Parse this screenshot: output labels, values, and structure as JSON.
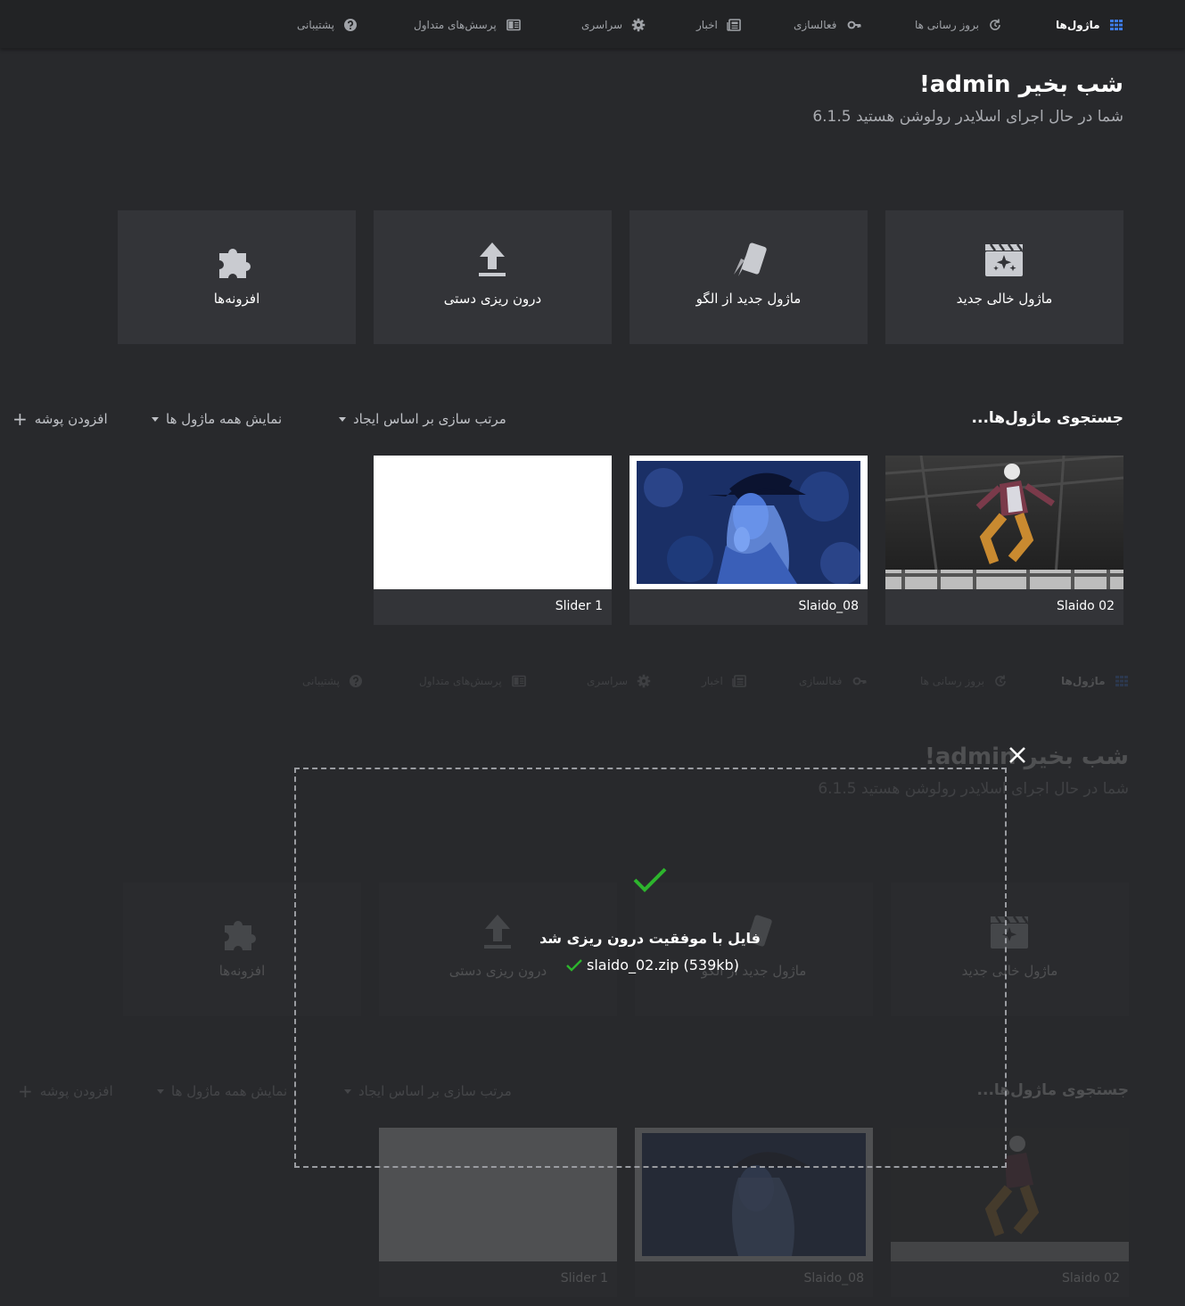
{
  "nav": {
    "items": [
      {
        "label": "ماژول‌ها",
        "icon": "grid-icon",
        "active": true
      },
      {
        "label": "بروز رسانی ها",
        "icon": "refresh-icon",
        "active": false
      },
      {
        "label": "فعالسازی",
        "icon": "key-icon",
        "active": false
      },
      {
        "label": "اخبار",
        "icon": "newspaper-icon",
        "active": false
      },
      {
        "label": "سراسری",
        "icon": "gear-icon",
        "active": false
      },
      {
        "label": "پرسش‌های متداول",
        "icon": "faq-book-icon",
        "active": false
      },
      {
        "label": "پشتیبانی",
        "icon": "help-icon",
        "active": false
      }
    ]
  },
  "header": {
    "greeting": "شب بخیر admin!",
    "subtitle": "شما در حال اجرای اسلایدر رولوشن هستید 6.1.5"
  },
  "tiles": [
    {
      "label": "ماژول خالی جدید",
      "icon": "clapperboard-sparkle-icon"
    },
    {
      "label": "ماژول جدید از الگو",
      "icon": "template-cards-icon"
    },
    {
      "label": "درون ریزی دستی",
      "icon": "upload-icon"
    },
    {
      "label": "افزونه‌ها",
      "icon": "puzzle-icon"
    }
  ],
  "toolbar": {
    "search_placeholder": "جستجوی ماژول‌ها...",
    "sort_label": "مرتب سازی بر اساس ایجاد",
    "filter_label": "نمایش همه ماژول ها",
    "add_folder_label": "افزودن پوشه"
  },
  "sliders": [
    {
      "title": "Slaido 02",
      "thumb": "jumping-person-photo"
    },
    {
      "title": "Slaido_08",
      "thumb": "blue-tinted-woman-hat-photo"
    },
    {
      "title": "Slider 1",
      "thumb": "blank-white"
    }
  ],
  "import_dialog": {
    "message": "فایل با موفقیت درون ریزی شد",
    "file_line": "slaido_02.zip (539kb)"
  },
  "colors": {
    "background": "#28292c",
    "topbar": "#222325",
    "tile": "#333438",
    "accent_blue": "#3d7be8",
    "success_green": "#2db52d"
  }
}
